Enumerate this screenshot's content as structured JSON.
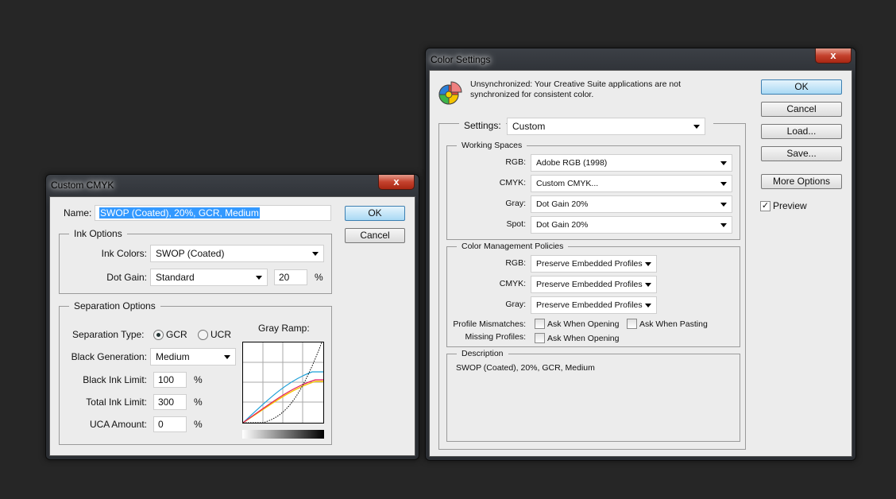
{
  "cmyk_dialog": {
    "title": "Custom CMYK",
    "close": "x",
    "name_label": "Name:",
    "name_value": "SWOP (Coated), 20%, GCR, Medium",
    "ok": "OK",
    "cancel": "Cancel",
    "ink_options": {
      "title": "Ink Options",
      "ink_colors_label": "Ink Colors:",
      "ink_colors_value": "SWOP (Coated)",
      "dot_gain_label": "Dot Gain:",
      "dot_gain_value": "Standard",
      "dot_gain_amount": "20",
      "percent": "%"
    },
    "separation": {
      "title": "Separation Options",
      "type_label": "Separation Type:",
      "gcr": "GCR",
      "ucr": "UCR",
      "selected": "GCR",
      "black_gen_label": "Black Generation:",
      "black_gen_value": "Medium",
      "black_ink_label": "Black Ink Limit:",
      "black_ink_value": "100",
      "total_ink_label": "Total Ink Limit:",
      "total_ink_value": "300",
      "uca_label": "UCA Amount:",
      "uca_value": "0",
      "percent": "%",
      "gray_ramp_label": "Gray Ramp:"
    }
  },
  "color_settings": {
    "title": "Color Settings",
    "close": "x",
    "sync_message": "Unsynchronized: Your Creative Suite applications are not synchronized for consistent color.",
    "settings_label": "Settings:",
    "settings_value": "Custom",
    "working_spaces": {
      "title": "Working Spaces",
      "items": [
        {
          "label": "RGB:",
          "value": "Adobe RGB (1998)"
        },
        {
          "label": "CMYK:",
          "value": "Custom CMYK..."
        },
        {
          "label": "Gray:",
          "value": "Dot Gain 20%"
        },
        {
          "label": "Spot:",
          "value": "Dot Gain 20%"
        }
      ]
    },
    "policies": {
      "title": "Color Management Policies",
      "items": [
        {
          "label": "RGB:",
          "value": "Preserve Embedded Profiles"
        },
        {
          "label": "CMYK:",
          "value": "Preserve Embedded Profiles"
        },
        {
          "label": "Gray:",
          "value": "Preserve Embedded Profiles"
        }
      ],
      "mismatch_label": "Profile Mismatches:",
      "ask_opening": "Ask When Opening",
      "ask_pasting": "Ask When Pasting",
      "missing_label": "Missing Profiles:",
      "missing_ask_opening": "Ask When Opening"
    },
    "description": {
      "title": "Description",
      "text": "SWOP (Coated), 20%, GCR, Medium"
    },
    "buttons": {
      "ok": "OK",
      "cancel": "Cancel",
      "load": "Load...",
      "save": "Save...",
      "more": "More Options"
    },
    "preview_label": "Preview",
    "preview_checked": true
  }
}
